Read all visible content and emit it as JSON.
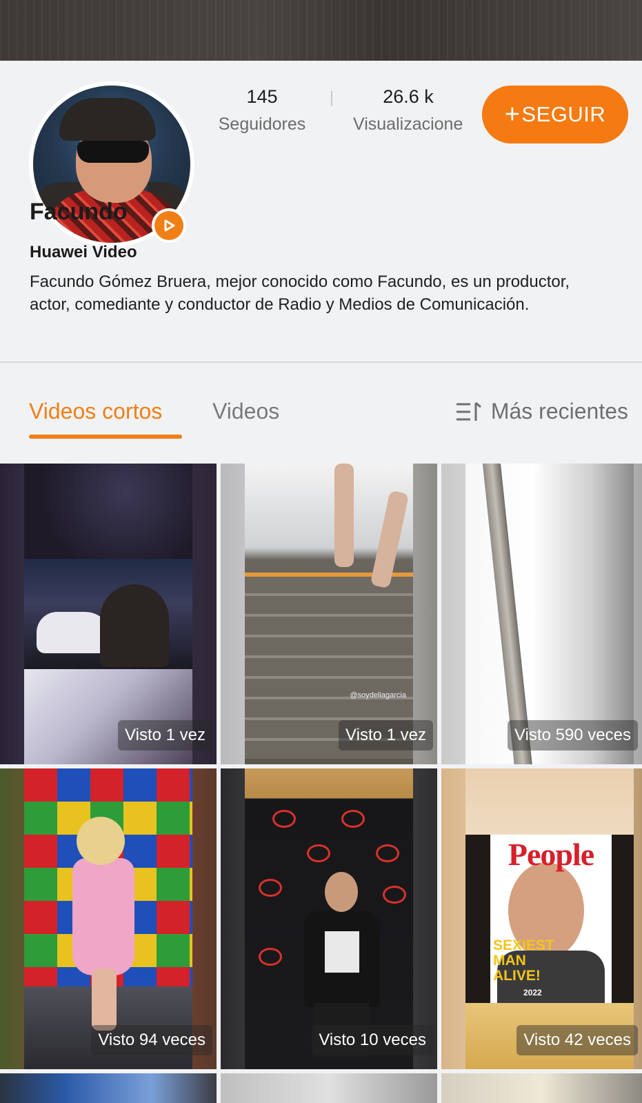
{
  "profile": {
    "name": "Facundo",
    "channel": "Huawei Video",
    "bio": "Facundo Gómez Bruera, mejor conocido como Facundo, es un productor, actor, comediante y conductor de Radio y Medios de Comunicación.",
    "followers_count": "145",
    "followers_label": "Seguidores",
    "views_count": "26.6 k",
    "views_label": "Visualizaciones",
    "follow_icon": "+",
    "follow_label": "SEGUIR",
    "badge_icon": "play-icon"
  },
  "tabs": {
    "short_videos": "Videos cortos",
    "videos": "Videos",
    "active": "Videos cortos",
    "sort_label": "Más recientes",
    "sort_icon": "sort-icon"
  },
  "videos": [
    {
      "views_text": "Visto 1 vez"
    },
    {
      "views_text": "Visto 1 vez",
      "watermark": "@soydeliagarcia"
    },
    {
      "views_text": "Visto 590 veces"
    },
    {
      "views_text": "Visto 94 veces"
    },
    {
      "views_text": "Visto 10 veces"
    },
    {
      "views_text": "Visto 42 veces",
      "cover_title": "People",
      "cover_line1": "SEXIEST",
      "cover_line2": "MAN",
      "cover_line3": "ALIVE!",
      "cover_year": "2022"
    }
  ],
  "colors": {
    "accent": "#f57a12",
    "background": "#f1f2f4",
    "text_primary": "#1b1b1b",
    "text_secondary": "#6c6c6c"
  }
}
